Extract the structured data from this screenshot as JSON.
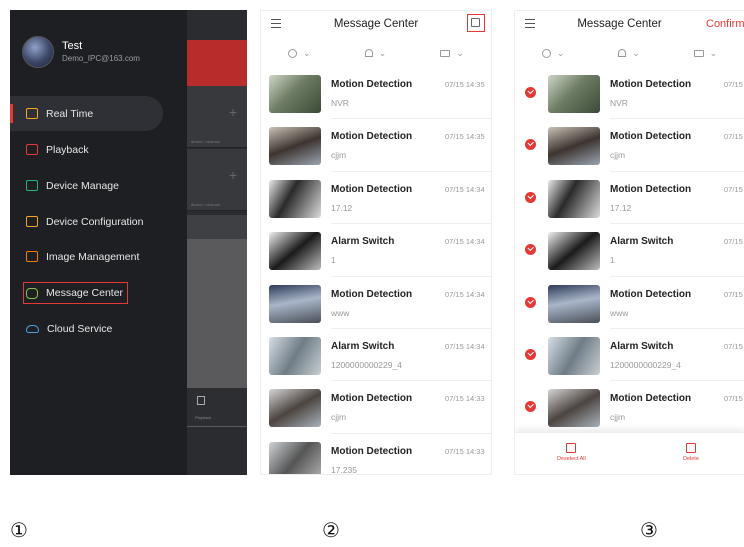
{
  "panel1": {
    "user": {
      "name": "Test",
      "email": "Demo_IPC@163.com"
    },
    "background": {
      "channel_label": "device / channel",
      "tab_label": "Playback"
    },
    "nav": [
      {
        "label": "Real Time",
        "icon": "play-icon",
        "color": "#f5a623"
      },
      {
        "label": "Playback",
        "icon": "film-icon",
        "color": "#e53935"
      },
      {
        "label": "Device Manage",
        "icon": "device-icon",
        "color": "#2bb37a"
      },
      {
        "label": "Device Configuration",
        "icon": "config-icon",
        "color": "#f5a623"
      },
      {
        "label": "Image Management",
        "icon": "image-icon",
        "color": "#f57c00"
      },
      {
        "label": "Message Center",
        "icon": "message-icon",
        "color": "#8bc34a"
      },
      {
        "label": "Cloud Service",
        "icon": "cloud-icon",
        "color": "#4a9fe0"
      }
    ]
  },
  "panel2": {
    "title": "Message Center"
  },
  "panel3": {
    "title": "Message Center",
    "confirm": "Confirm",
    "deselect": "Deselect All",
    "delete": "Delete"
  },
  "messages": [
    {
      "title": "Motion Detection",
      "sub": "NVR",
      "time": "07/15 14:35"
    },
    {
      "title": "Motion Detection",
      "sub": "cjjm",
      "time": "07/15 14:35"
    },
    {
      "title": "Motion Detection",
      "sub": "17.12",
      "time": "07/15 14:34"
    },
    {
      "title": "Alarm Switch",
      "sub": "1",
      "time": "07/15 14:34"
    },
    {
      "title": "Motion Detection",
      "sub": "www",
      "time": "07/15 14:34"
    },
    {
      "title": "Alarm Switch",
      "sub": "1200000000229_4",
      "time": "07/15 14:34"
    },
    {
      "title": "Motion Detection",
      "sub": "cjjm",
      "time": "07/15 14:33"
    },
    {
      "title": "Motion Detection",
      "sub": "17.235",
      "time": "07/15 14:33"
    }
  ],
  "captions": [
    "①",
    "②",
    "③"
  ]
}
